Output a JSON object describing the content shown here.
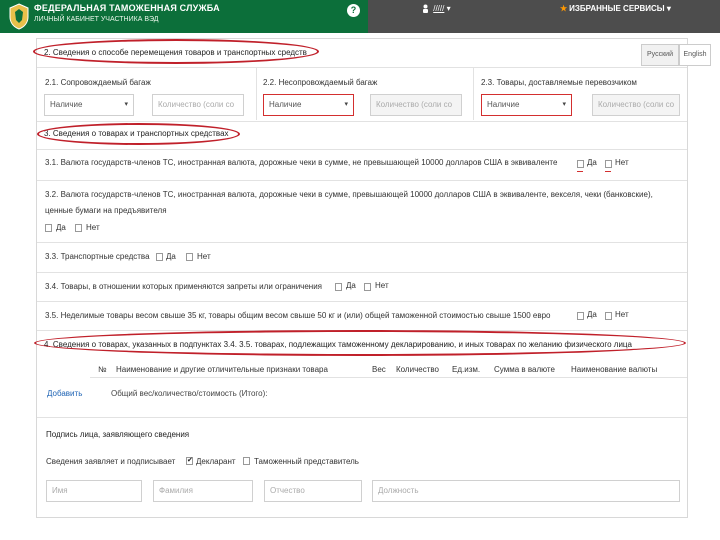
{
  "header": {
    "brand_title": "ФЕДЕРАЛЬНАЯ ТАМОЖЕННАЯ СЛУЖБА",
    "brand_subtitle": "ЛИЧНЫЙ КАБИНЕТ УЧАСТНИКА ВЭД",
    "help_glyph": "?",
    "user_name": "/////",
    "user_caret": "▾",
    "favorites_label": "ИЗБРАННЫЕ СЕРВИСЫ",
    "favorites_caret": "▾",
    "colors": {
      "brand_green": "#0c6f3a",
      "bar_grey": "#4d4d4d",
      "accent_orange": "#ff9800"
    },
    "icons": [
      "emblem-icon",
      "help-icon",
      "user-icon",
      "star-icon"
    ]
  },
  "language": {
    "ru": "Русский",
    "en": "English"
  },
  "section2": {
    "title": "2. Сведения о способе перемещения товаров и транспортных средств",
    "columns": [
      {
        "title": "2.1. Сопровождаемый багаж",
        "select_value": "Наличие",
        "caret": "▾",
        "qty_placeholder": "Количество (соли со"
      },
      {
        "title": "2.2. Несопровождаемый багаж",
        "select_value": "Наличие",
        "caret": "▾",
        "qty_placeholder": "Количество (соли со"
      },
      {
        "title": "2.3. Товары, доставляемые перевозчиком",
        "select_value": "Наличие",
        "caret": "▾",
        "qty_placeholder": "Количество (соли со"
      }
    ]
  },
  "section3": {
    "title": "3. Сведения о товарах и транспортных средствах",
    "yes": "Да",
    "no": "Нет",
    "q31": "3.1. Валюта государств-членов ТС, иностранная валюта, дорожные чеки в сумме, не превышающей 10000 долларов США в эквиваленте",
    "q32_line1": "3.2. Валюта государств-членов ТС, иностранная валюта, дорожные чеки в сумме, превышающей 10000 долларов США в эквиваленте, векселя, чеки (банковские),",
    "q32_line2": "ценные бумаги на предъявителя",
    "q33": "3.3. Транспортные средства",
    "q34": "3.4. Товары, в отношении которых применяются запреты или ограничения",
    "q35": "3.5. Неделимые товары весом свыше 35 кг, товары общим весом свыше 50 кг и (или) общей таможенной стоимостью свыше 1500 евро"
  },
  "section4": {
    "title": "4. Сведения о товарах, указанных в подпунктах 3.4. 3.5. товарах, подлежащих таможенному декларированию, и иных товарах по желанию физического лица",
    "columns": [
      "№",
      "Наименование и другие отличительные признаки товара",
      "Вес",
      "Количество",
      "Ед.изм.",
      "Сумма в валюте",
      "Наименование валюты"
    ],
    "add_link": "Добавить",
    "summary": "Общий вес/количество/стоимость (Итого):"
  },
  "signature": {
    "title": "Подпись лица, заявляющего сведения",
    "declared_label": "Сведения заявляет и подписывает",
    "option_declarant": "Декларант",
    "option_rep": "Таможенный представитель",
    "first_name": "Имя",
    "last_name": "Фамилия",
    "patronymic": "Отчество",
    "position": "Должность"
  }
}
